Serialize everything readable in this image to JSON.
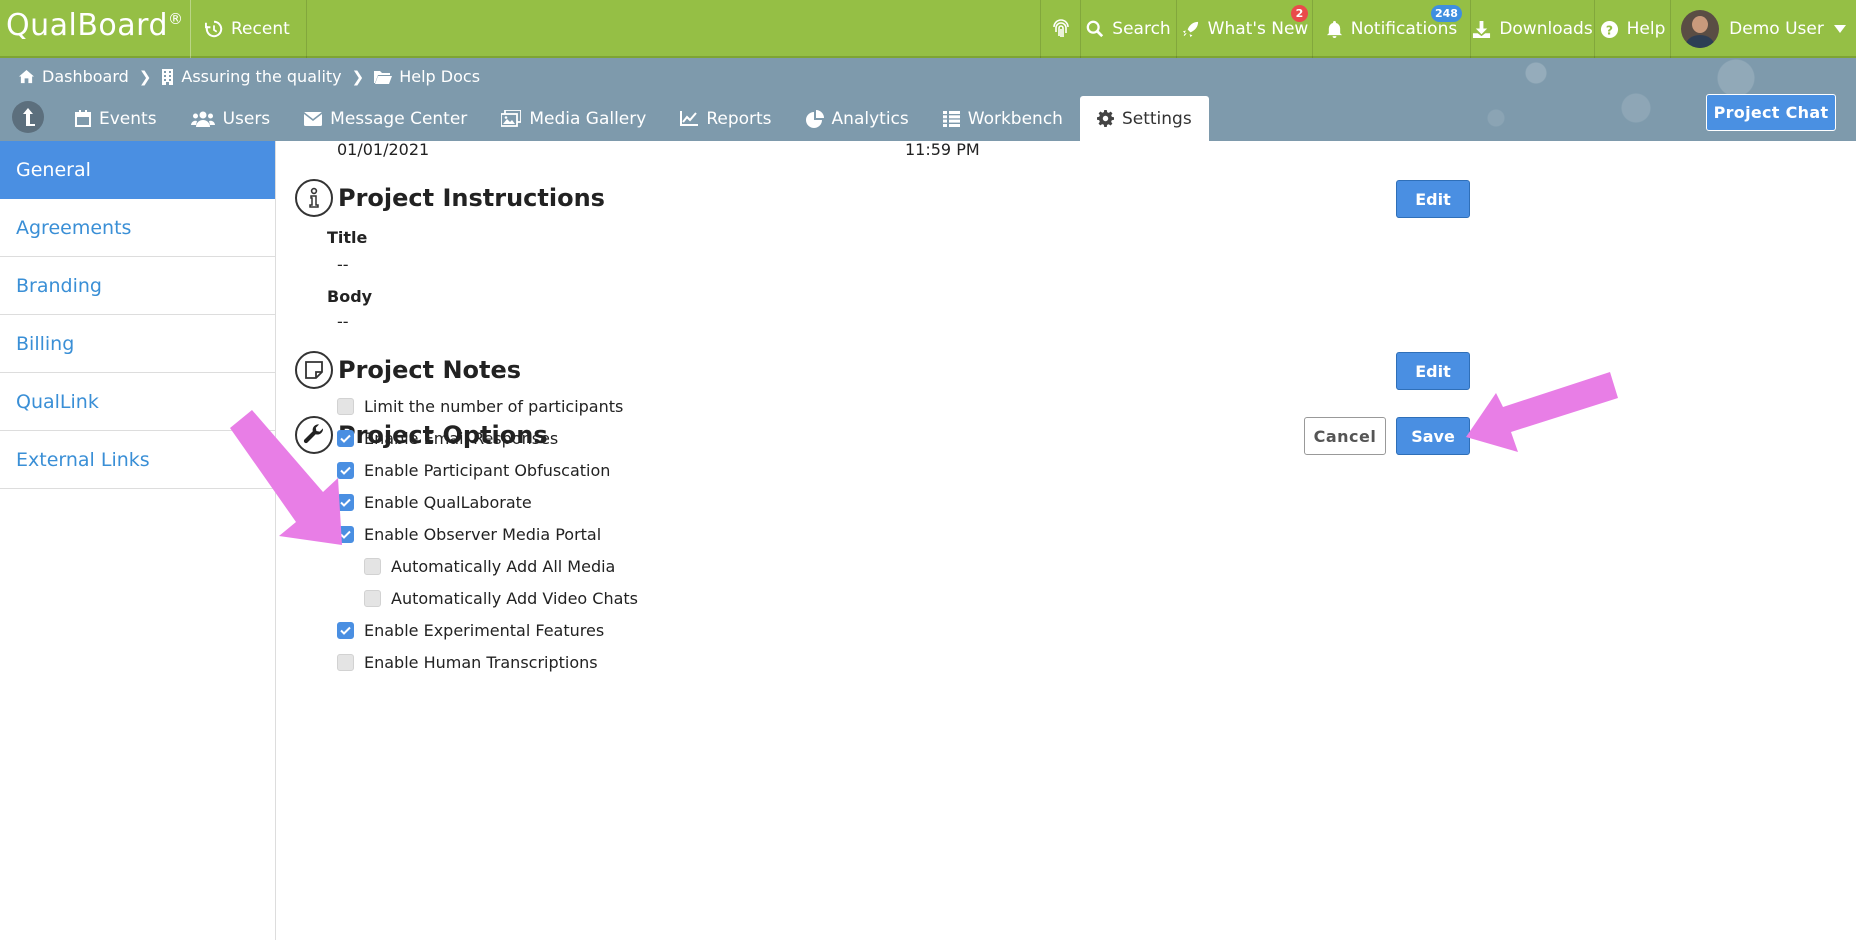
{
  "app": {
    "logo": "QualBoard",
    "logo_mark": "®",
    "recent": "Recent"
  },
  "topnav": {
    "search": "Search",
    "whats_new": "What's New",
    "whats_new_badge": "2",
    "notifications": "Notifications",
    "notifications_badge": "248",
    "downloads": "Downloads",
    "help": "Help",
    "user": "Demo User"
  },
  "breadcrumb": {
    "items": [
      "Dashboard",
      "Assuring the quality",
      "Help Docs"
    ]
  },
  "tabs": [
    "Events",
    "Users",
    "Message Center",
    "Media Gallery",
    "Reports",
    "Analytics",
    "Workbench",
    "Settings"
  ],
  "active_tab": "Settings",
  "project_chat": "Project Chat",
  "sidebar": {
    "items": [
      "General",
      "Agreements",
      "Branding",
      "Billing",
      "QualLink",
      "External Links"
    ],
    "active": "General"
  },
  "main": {
    "partial_date": "01/01/2021",
    "partial_time": "11:59 PM",
    "instructions": {
      "title": "Project Instructions",
      "edit": "Edit",
      "title_label": "Title",
      "title_value": "--",
      "body_label": "Body",
      "body_value": "--"
    },
    "notes": {
      "title": "Project Notes",
      "edit": "Edit"
    },
    "options": {
      "title": "Project Options",
      "cancel": "Cancel",
      "save": "Save",
      "items": [
        {
          "label": "Limit the number of participants",
          "checked": false
        },
        {
          "label": "Enable Email Responses",
          "checked": true
        },
        {
          "label": "Enable Participant Obfuscation",
          "checked": true
        },
        {
          "label": "Enable QualLaborate",
          "checked": true
        },
        {
          "label": "Enable Observer Media Portal",
          "checked": true
        },
        {
          "label": "Automatically Add All Media",
          "checked": false
        },
        {
          "label": "Automatically Add Video Chats",
          "checked": false
        },
        {
          "label": "Enable Experimental Features",
          "checked": true
        },
        {
          "label": "Enable Human Transcriptions",
          "checked": false
        }
      ]
    }
  },
  "colors": {
    "topbar": "#95bf45",
    "subbar": "#7e9aac",
    "accent": "#4a8fe2",
    "annotation_arrow": "#e87ee6"
  },
  "icons": [
    "history-icon",
    "fingerprint-icon",
    "search-icon",
    "rocket-icon",
    "bell-icon",
    "download-icon",
    "help-icon",
    "home-icon",
    "building-icon",
    "folder-icon",
    "calendar-icon",
    "users-icon",
    "envelope-icon",
    "images-icon",
    "chart-line-icon",
    "pie-chart-icon",
    "list-icon",
    "gear-icon",
    "info-icon",
    "note-icon",
    "wrench-icon",
    "check-icon"
  ]
}
